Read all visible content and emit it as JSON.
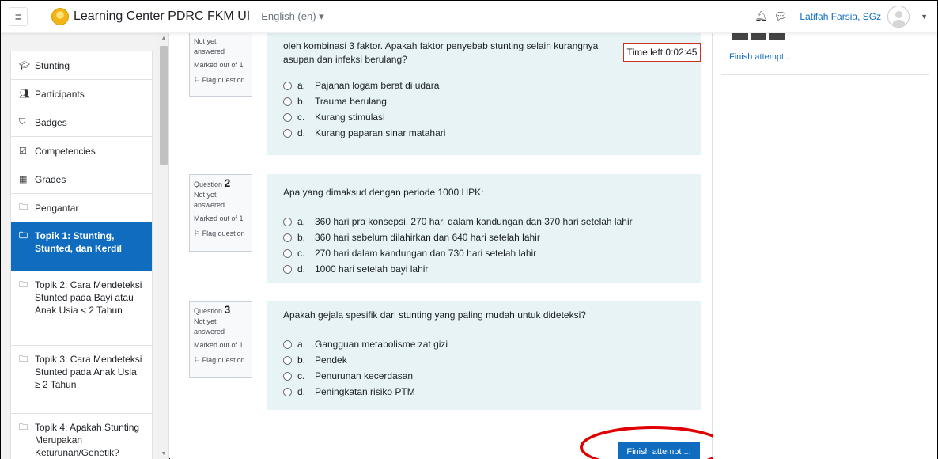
{
  "navbar": {
    "menu_icon": "hamburger-icon",
    "site_name": "Learning Center PDRC FKM UI",
    "language": "English (en) ▾",
    "notification_icon": "bell-icon",
    "messages_icon": "chat-icon",
    "user_name": "Latifah Farsia, SGz",
    "user_menu_caret": "▼"
  },
  "drawer": {
    "items": [
      {
        "icon": "graduation-cap-icon",
        "glyph": "🎓",
        "label": "Stunting"
      },
      {
        "icon": "users-icon",
        "glyph": "👥",
        "label": "Participants"
      },
      {
        "icon": "shield-icon",
        "glyph": "⛉",
        "label": "Badges"
      },
      {
        "icon": "check-square-icon",
        "glyph": "☑",
        "label": "Competencies"
      },
      {
        "icon": "table-icon",
        "glyph": "▦",
        "label": "Grades"
      },
      {
        "icon": "folder-icon",
        "glyph": "🗀",
        "label": "Pengantar"
      },
      {
        "icon": "folder-icon",
        "glyph": "🗀",
        "label": "Topik 1: Stunting, Stunted, dan Kerdil"
      },
      {
        "icon": "folder-icon",
        "glyph": "🗀",
        "label": "Topik 2: Cara Mendeteksi Stunted pada Bayi atau Anak Usia < 2 Tahun"
      },
      {
        "icon": "folder-icon",
        "glyph": "🗀",
        "label": "Topik 3: Cara Mendeteksi Stunted pada Anak Usia ≥ 2 Tahun"
      },
      {
        "icon": "folder-icon",
        "glyph": "🗀",
        "label": "Topik 4: Apakah Stunting Merupakan Keturunan/Genetik?"
      }
    ],
    "scroll_up": "▲",
    "scroll_down": "▼"
  },
  "quiz": {
    "timer": "Time left 0:02:45",
    "questions": [
      {
        "number_label": "",
        "number": "",
        "status": "Not yet answered",
        "marked": "Marked out of 1",
        "flag": "⚐ Flag question",
        "text": "oleh kombinasi 3 faktor. Apakah faktor penyebab stunting selain kurangnya asupan dan infeksi berulang?",
        "answers": [
          {
            "letter": "a.",
            "text": "Pajanan logam berat di udara"
          },
          {
            "letter": "b.",
            "text": "Trauma berulang"
          },
          {
            "letter": "c.",
            "text": "Kurang stimulasi"
          },
          {
            "letter": "d.",
            "text": "Kurang paparan sinar matahari"
          }
        ]
      },
      {
        "number_label": "Question",
        "number": "2",
        "status": "Not yet answered",
        "marked": "Marked out of 1",
        "flag": "⚐ Flag question",
        "text": "Apa yang dimaksud dengan periode 1000 HPK:",
        "answers": [
          {
            "letter": "a.",
            "text": "360 hari pra konsepsi, 270 hari dalam kandungan dan 370 hari setelah lahir"
          },
          {
            "letter": "b.",
            "text": "360 hari sebelum dilahirkan dan 640 hari setelah lahir"
          },
          {
            "letter": "c.",
            "text": "270 hari dalam kandungan dan 730 hari setelah lahir"
          },
          {
            "letter": "d.",
            "text": "1000 hari setelah bayi lahir"
          }
        ]
      },
      {
        "number_label": "Question",
        "number": "3",
        "status": "Not yet answered",
        "marked": "Marked out of 1",
        "flag": "⚐ Flag question",
        "text": "Apakah gejala spesifik dari stunting yang paling mudah untuk dideteksi?",
        "answers": [
          {
            "letter": "a.",
            "text": "Gangguan metabolisme zat gizi"
          },
          {
            "letter": "b.",
            "text": "Pendek"
          },
          {
            "letter": "c.",
            "text": "Penurunan kecerdasan"
          },
          {
            "letter": "d.",
            "text": "Peningkatan risiko PTM"
          }
        ]
      }
    ],
    "finish_button": "Finish attempt ...",
    "highlight_color": "#e00000"
  },
  "quiz_navigation": {
    "finish_link": "Finish attempt ..."
  },
  "colors": {
    "primary": "#0f6cbf",
    "question_bg": "#e7f3f5",
    "timer_border": "#ca3120"
  }
}
